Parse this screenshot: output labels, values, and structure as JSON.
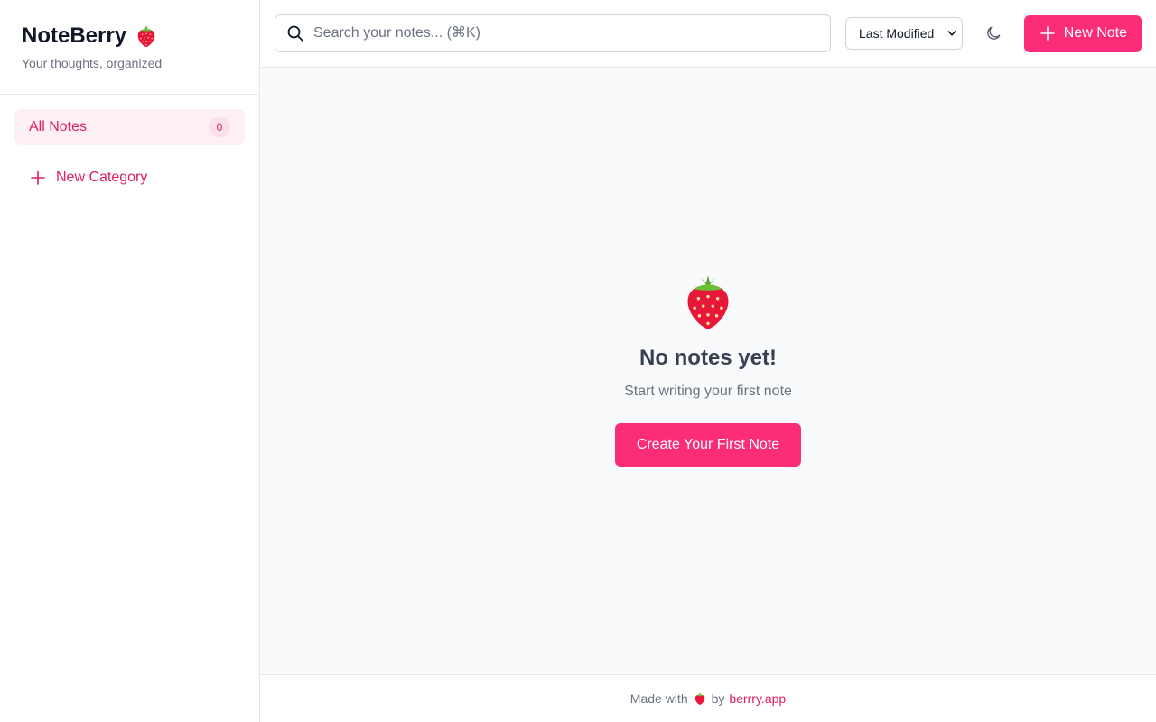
{
  "brand": {
    "title": "NoteBerry",
    "tagline": "Your thoughts, organized",
    "emoji_icon": "strawberry-icon"
  },
  "sidebar": {
    "items": [
      {
        "label": "All Notes",
        "count": "0"
      }
    ],
    "new_category_label": "New Category"
  },
  "topbar": {
    "search_placeholder": "Search your notes... (⌘K)",
    "search_value": "",
    "sort_selected": "Last Modified",
    "theme_icon": "moon-icon",
    "new_note_label": "New Note"
  },
  "empty_state": {
    "icon": "strawberry-icon",
    "title": "No notes yet!",
    "subtitle": "Start writing your first note",
    "cta_label": "Create Your First Note"
  },
  "footer": {
    "prefix": "Made with",
    "by": "by",
    "link_text": "berrry.app"
  },
  "colors": {
    "accent": "#fb2d78",
    "accent_text": "#e11d5f",
    "accent_soft": "#fdf0f4"
  }
}
